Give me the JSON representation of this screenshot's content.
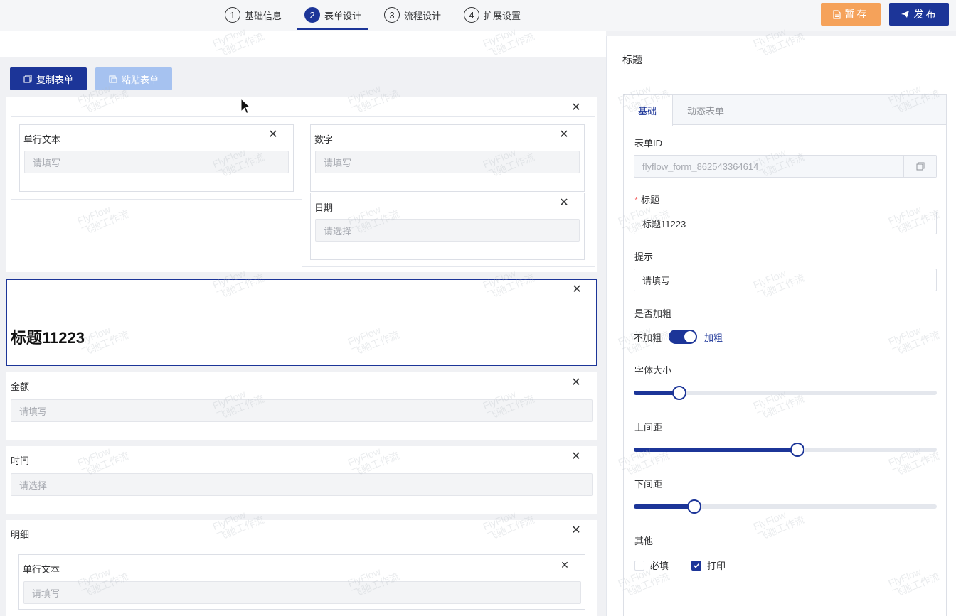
{
  "steps": [
    {
      "num": "1",
      "label": "基础信息"
    },
    {
      "num": "2",
      "label": "表单设计"
    },
    {
      "num": "3",
      "label": "流程设计"
    },
    {
      "num": "4",
      "label": "扩展设置"
    }
  ],
  "header": {
    "save_label": "暂存",
    "publish_label": "发布"
  },
  "toolbar": {
    "copy_label": "复制表单",
    "paste_label": "粘贴表单"
  },
  "form": {
    "col_left": {
      "label": "单行文本",
      "placeholder": "请填写"
    },
    "col_right_number": {
      "label": "数字",
      "placeholder": "请填写"
    },
    "col_right_date": {
      "label": "日期",
      "placeholder": "请选择"
    },
    "title_text": "标题11223",
    "amount": {
      "label": "金额",
      "placeholder": "请填写"
    },
    "time": {
      "label": "时间",
      "placeholder": "请选择"
    },
    "detail": {
      "label": "明细",
      "inner_label": "单行文本",
      "inner_placeholder": "请填写"
    }
  },
  "panel": {
    "title": "标题",
    "tabs": [
      "基础",
      "动态表单"
    ],
    "form_id_label": "表单ID",
    "form_id_value": "flyflow_form_862543364614",
    "title_label": "标题",
    "title_value": "标题11223",
    "hint_label": "提示",
    "hint_value": "请填写",
    "bold_label": "是否加粗",
    "bold_off": "不加粗",
    "bold_on": "加粗",
    "bold_enabled": true,
    "font_size_label": "字体大小",
    "font_size_fraction": 0.15,
    "margin_top_label": "上间距",
    "margin_top_fraction": 0.54,
    "margin_bottom_label": "下间距",
    "margin_bottom_fraction": 0.2,
    "other_label": "其他",
    "required_label": "必填",
    "required_checked": false,
    "print_label": "打印",
    "print_checked": true
  },
  "watermark": {
    "line1": "FlyFlow",
    "line2": "飞驰工作流"
  },
  "colors": {
    "primary": "#1c3598",
    "save": "#f5a25a",
    "paste": "#a6c2f0"
  }
}
